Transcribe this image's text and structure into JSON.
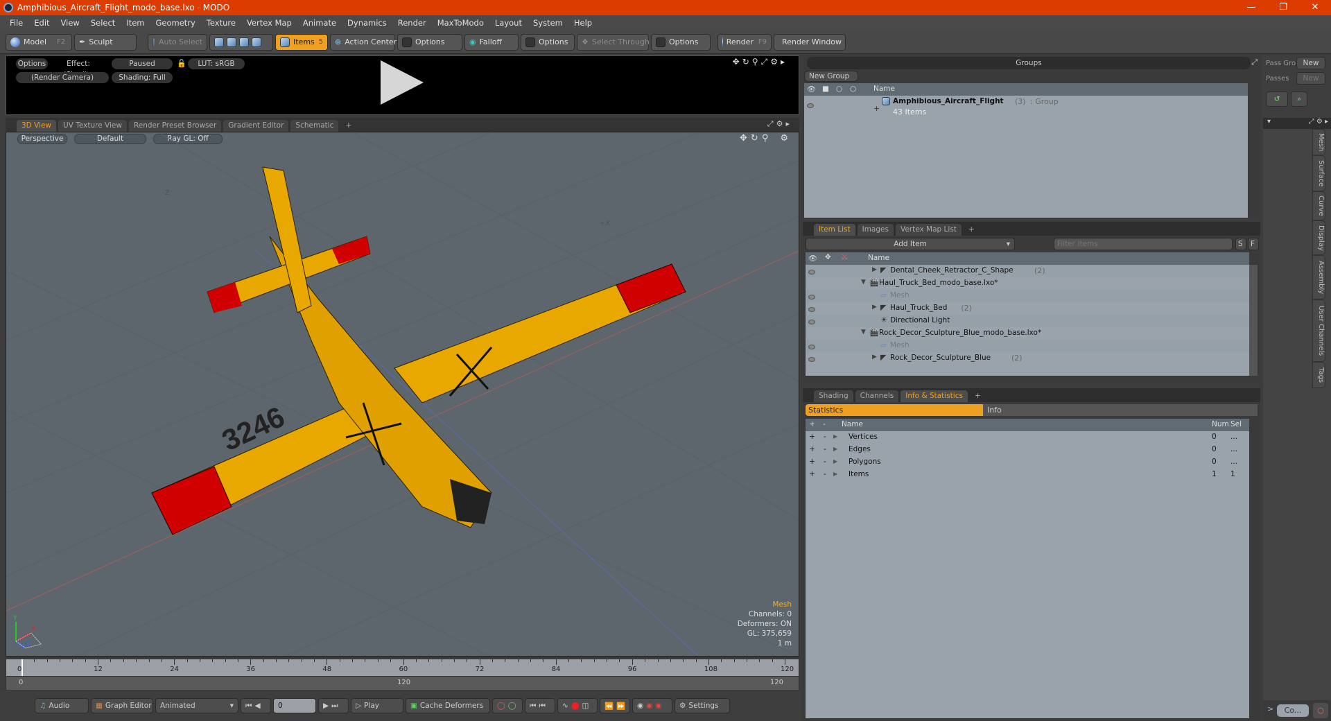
{
  "window": {
    "title": "Amphibious_Aircraft_Flight_modo_base.lxo - MODO",
    "controls": [
      "minimize",
      "restore",
      "close"
    ]
  },
  "menu": [
    "File",
    "Edit",
    "View",
    "Select",
    "Item",
    "Geometry",
    "Texture",
    "Vertex Map",
    "Animate",
    "Dynamics",
    "Render",
    "MaxToModo",
    "Layout",
    "System",
    "Help"
  ],
  "toolbar": {
    "model": "Model",
    "model_key": "F2",
    "sculpt": "Sculpt",
    "auto_select": "Auto Select",
    "items": "Items",
    "items_key": "5",
    "action_center": "Action Center",
    "options1": "Options",
    "falloff": "Falloff",
    "options2": "Options",
    "select_through": "Select Through",
    "options3": "Options",
    "render": "Render",
    "render_key": "F9",
    "render_window": "Render Window"
  },
  "preview": {
    "options": "Options",
    "effect": "Effect: (Shadi...",
    "paused": "Paused",
    "lut": "LUT: sRGB",
    "camera": "(Render Camera)",
    "shading": "Shading: Full"
  },
  "viewport_tabs": [
    {
      "label": "3D View",
      "active": true
    },
    {
      "label": "UV Texture View"
    },
    {
      "label": "Render Preset Browser"
    },
    {
      "label": "Gradient Editor"
    },
    {
      "label": "Schematic"
    }
  ],
  "viewport": {
    "perspective": "Perspective",
    "default": "Default",
    "raygl": "Ray GL: Off",
    "axis_neg_z": "-Z",
    "axis_pos_x": "+X",
    "info": {
      "title": "Mesh",
      "channels": "Channels: 0",
      "deformers": "Deformers: ON",
      "gl": "GL: 375,659",
      "scale": "1 m"
    },
    "model_label": "3246",
    "gizmo": {
      "y": "Y",
      "x": "X",
      "z": "Z"
    }
  },
  "timeline": {
    "ticks": [
      "0",
      "12",
      "24",
      "36",
      "48",
      "60",
      "72",
      "84",
      "96",
      "108",
      "120"
    ],
    "range_start": "0",
    "range_mid": "120",
    "range_end": "120"
  },
  "transport": {
    "audio": "Audio",
    "graph_editor": "Graph Editor",
    "animated": "Animated",
    "frame": "0",
    "play": "Play",
    "cache_deformers": "Cache Deformers",
    "settings": "Settings"
  },
  "groups": {
    "title": "Groups",
    "new_group": "New Group",
    "col_name": "Name",
    "rows": [
      {
        "name": "Amphibious_Aircraft_Flight",
        "count": "(3)",
        "type": ": Group",
        "sub": "43 Items"
      }
    ]
  },
  "passes": {
    "pass_groups": "Pass Gro",
    "new1": "New",
    "passes": "Passes",
    "new2": "New"
  },
  "item_list": {
    "tabs": [
      {
        "label": "Item List",
        "active": true
      },
      {
        "label": "Images"
      },
      {
        "label": "Vertex Map List"
      }
    ],
    "add_item": "Add Item",
    "filter_placeholder": "Filter Items",
    "s": "S",
    "f": "F",
    "col_name": "Name",
    "rows": [
      {
        "indent": 2,
        "name": "Dental_Cheek_Retractor_C_Shape",
        "count": "(2)",
        "icon": "group",
        "eye": true,
        "arrow": "right"
      },
      {
        "indent": 1,
        "name": "Haul_Truck_Bed_modo_base.lxo*",
        "count": "",
        "icon": "scene",
        "eye": false,
        "arrow": "down"
      },
      {
        "indent": 2,
        "name": "Mesh",
        "count": "",
        "icon": "mesh",
        "eye": true,
        "dim": true
      },
      {
        "indent": 2,
        "name": "Haul_Truck_Bed",
        "count": "(2)",
        "icon": "group",
        "eye": true,
        "arrow": "right"
      },
      {
        "indent": 2,
        "name": "Directional Light",
        "count": "",
        "icon": "light",
        "eye": true
      },
      {
        "indent": 1,
        "name": "Rock_Decor_Sculpture_Blue_modo_base.lxo*",
        "count": "",
        "icon": "scene",
        "eye": false,
        "arrow": "down"
      },
      {
        "indent": 2,
        "name": "Mesh",
        "count": "",
        "icon": "mesh",
        "eye": true,
        "dim": true
      },
      {
        "indent": 2,
        "name": "Rock_Decor_Sculpture_Blue",
        "count": "(2)",
        "icon": "group",
        "eye": true,
        "arrow": "right"
      }
    ]
  },
  "stats": {
    "tabs": [
      {
        "label": "Shading"
      },
      {
        "label": "Channels"
      },
      {
        "label": "Info & Statistics",
        "active": true
      }
    ],
    "sub_tabs": {
      "statistics": "Statistics",
      "info": "Info"
    },
    "cols": {
      "plus": "+",
      "minus": "-",
      "name": "Name",
      "num": "Num",
      "sel": "Sel"
    },
    "rows": [
      {
        "name": "Vertices",
        "num": "0",
        "sel": "..."
      },
      {
        "name": "Edges",
        "num": "0",
        "sel": "..."
      },
      {
        "name": "Polygons",
        "num": "0",
        "sel": "..."
      },
      {
        "name": "Items",
        "num": "1",
        "sel": "1"
      }
    ]
  },
  "side_tabs": [
    "Mesh",
    "Surface",
    "Curve",
    "Display",
    "Assembly",
    "User Channels",
    "Tags"
  ],
  "bottom_right": {
    "co": "Co..."
  }
}
